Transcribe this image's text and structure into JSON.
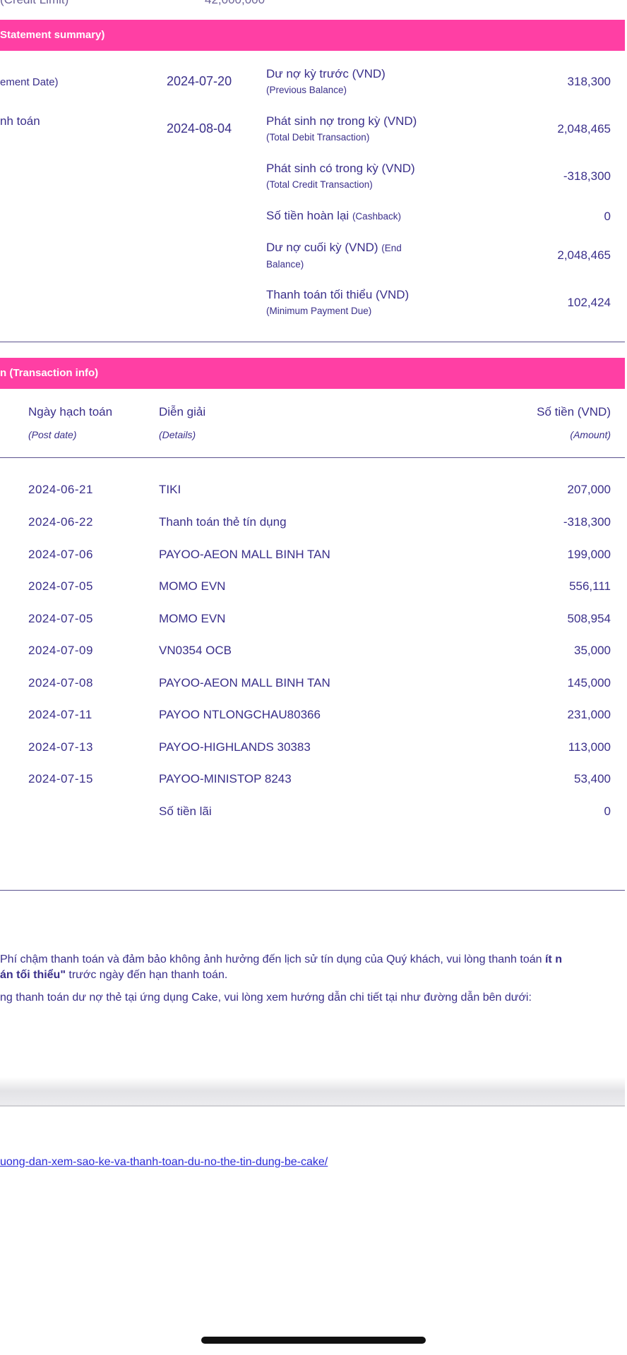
{
  "top": {
    "label": "(Credit Limit)",
    "value": "42,000,000"
  },
  "summary_bar": "Statement summary)",
  "left_dates": [
    {
      "label": "ement Date)",
      "value": "2024-07-20"
    },
    {
      "label": "nh toán",
      "value": "2024-08-04"
    }
  ],
  "summary_rows": [
    {
      "title": "Dư nợ kỳ trước (VND)",
      "sub": "(Previous Balance)",
      "amount": "318,300"
    },
    {
      "title": "Phát sinh nợ trong kỳ (VND)",
      "sub": "(Total Debit Transaction)",
      "amount": "2,048,465"
    },
    {
      "title": "Phát sinh có trong kỳ (VND)",
      "sub": "(Total Credit Transaction)",
      "amount": "-318,300"
    },
    {
      "title": "Số tiền hoàn lại",
      "sub": "(Cashback)",
      "amount": "0"
    },
    {
      "title": "Dư nợ cuối kỳ (VND)",
      "sub": "(End Balance)",
      "amount": "2,048,465"
    },
    {
      "title": "Thanh toán tối thiểu (VND)",
      "sub": "(Minimum Payment Due)",
      "amount": "102,424"
    }
  ],
  "tx_bar": "n (Transaction info)",
  "tx_header": {
    "date": "Ngày hạch toán",
    "date_sub": "(Post date)",
    "details": "Diễn giải",
    "details_sub": "(Details)",
    "amount": "Số tiền (VND)",
    "amount_sub": "(Amount)"
  },
  "transactions": [
    {
      "date": "2024-06-21",
      "details": "TIKI",
      "amount": "207,000"
    },
    {
      "date": "2024-06-22",
      "details": "Thanh toán thẻ tín dụng",
      "amount": "-318,300"
    },
    {
      "date": "2024-07-06",
      "details": "PAYOO-AEON MALL BINH TAN",
      "amount": "199,000"
    },
    {
      "date": "2024-07-05",
      "details": "MOMO EVN",
      "amount": "556,111"
    },
    {
      "date": "2024-07-05",
      "details": "MOMO EVN",
      "amount": "508,954"
    },
    {
      "date": "2024-07-09",
      "details": "VN0354 OCB",
      "amount": "35,000"
    },
    {
      "date": "2024-07-08",
      "details": "PAYOO-AEON MALL BINH TAN",
      "amount": "145,000"
    },
    {
      "date": "2024-07-11",
      "details": "PAYOO NTLONGCHAU80366",
      "amount": "231,000"
    },
    {
      "date": "2024-07-13",
      "details": "PAYOO-HIGHLANDS 30383",
      "amount": "113,000"
    },
    {
      "date": "2024-07-15",
      "details": "PAYOO-MINISTOP 8243",
      "amount": "53,400"
    },
    {
      "date": "",
      "details": "Số tiền lãi",
      "amount": "0"
    }
  ],
  "notes": {
    "line1_pre": "Phí chậm thanh toán và đảm bảo không ảnh hưởng đến lịch sử tín dụng của Quý khách, vui lòng thanh toán ",
    "line1_bold": "ít n",
    "line2_bold": "án tối thiểu\"",
    "line2_post": " trước ngày đến hạn thanh toán.",
    "line3": "ng thanh toán dư nợ thẻ tại ứng dụng Cake, vui lòng xem hướng dẫn chi tiết tại như đường dẫn bên dưới:"
  },
  "link": "uong-dan-xem-sao-ke-va-thanh-toan-du-no-the-tin-dung-be-cake/"
}
